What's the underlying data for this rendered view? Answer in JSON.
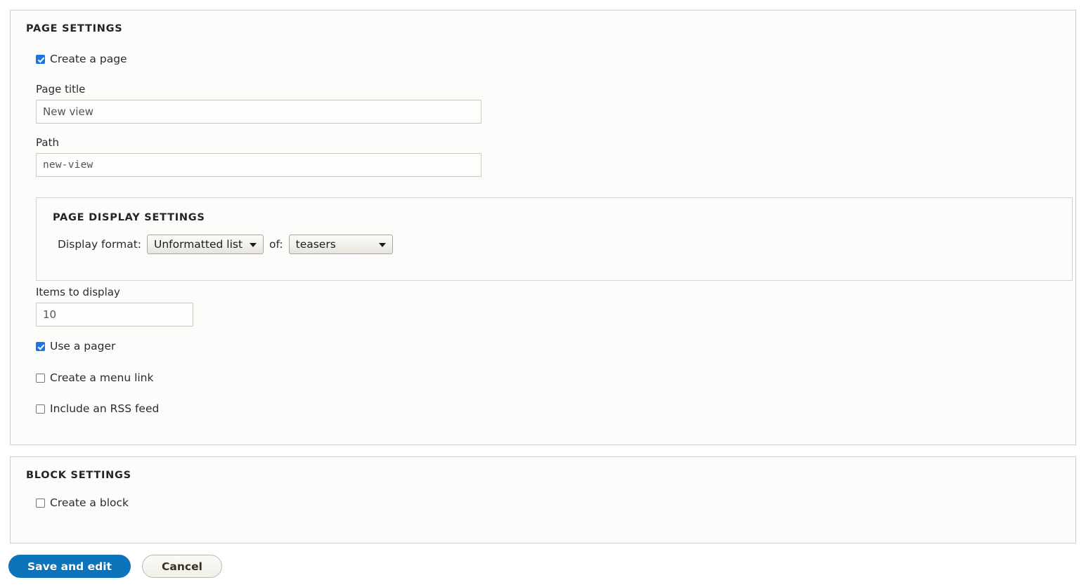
{
  "page_settings": {
    "legend": "Page settings",
    "create_page": {
      "label": "Create a page",
      "checked": true
    },
    "page_title": {
      "label": "Page title",
      "value": "New view"
    },
    "path": {
      "label": "Path",
      "value": "new-view"
    },
    "display_settings": {
      "legend": "Page display settings",
      "display_format_label": "Display format:",
      "format_value": "Unformatted list",
      "of_label": "of:",
      "of_value": "teasers"
    },
    "items_to_display": {
      "label": "Items to display",
      "value": "10"
    },
    "use_pager": {
      "label": "Use a pager",
      "checked": true
    },
    "create_menu_link": {
      "label": "Create a menu link",
      "checked": false
    },
    "include_rss_feed": {
      "label": "Include an RSS feed",
      "checked": false
    }
  },
  "block_settings": {
    "legend": "Block settings",
    "create_block": {
      "label": "Create a block",
      "checked": false
    }
  },
  "actions": {
    "save_label": "Save and edit",
    "cancel_label": "Cancel"
  },
  "colors": {
    "accent": "#0d74bb",
    "checkbox_checked": "#1a73e8",
    "fieldset_bg": "#fcfcfa",
    "fieldset_border": "#cdcdc8",
    "page_bg": "#ffffff"
  }
}
